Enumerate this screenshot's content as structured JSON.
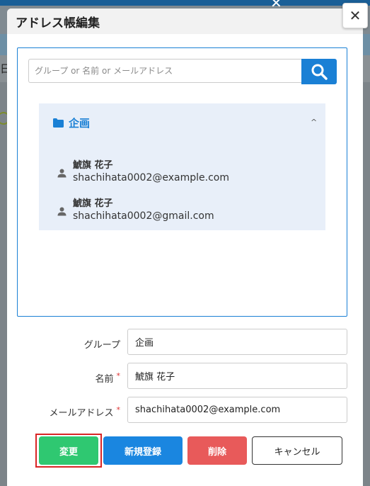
{
  "background": {
    "partial_text": "日"
  },
  "modal": {
    "title": "アドレス帳編集",
    "close_symbol": "✕"
  },
  "search": {
    "placeholder": "グループ or 名前 or メールアドレス",
    "icon": "search-icon"
  },
  "group": {
    "name": "企画",
    "expanded": true,
    "entries": [
      {
        "name": "鯱旗 花子",
        "email": "shachihata0002@example.com"
      },
      {
        "name": "鯱旗 花子",
        "email": "shachihata0002@gmail.com"
      }
    ]
  },
  "form": {
    "group_label": "グループ",
    "group_value": "企画",
    "name_label": "名前",
    "name_value": "鯱旗 花子",
    "email_label": "メールアドレス",
    "email_value": "shachihata0002@example.com",
    "required_mark": "*"
  },
  "buttons": {
    "change": "変更",
    "new": "新規登録",
    "delete": "削除",
    "cancel": "キャンセル"
  },
  "colors": {
    "primary": "#1a80d5",
    "change": "#2fc871",
    "delete": "#e85a5a",
    "highlight_outline": "#d92525"
  }
}
